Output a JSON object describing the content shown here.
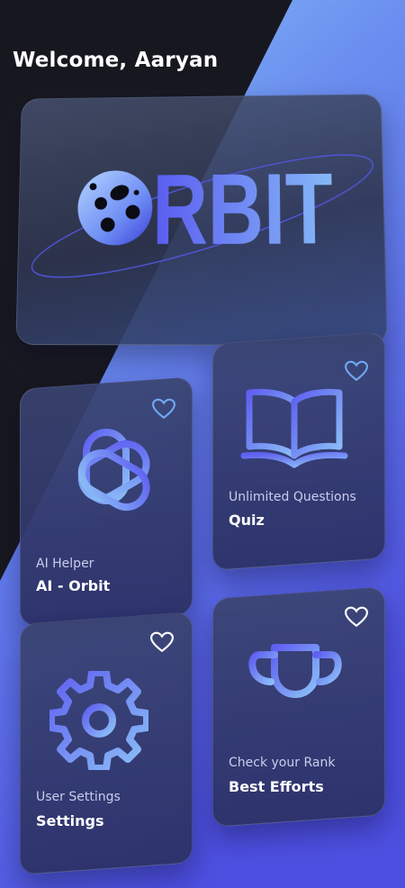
{
  "greeting": "Welcome, Aaryan",
  "hero": {
    "logo_text": "RBIT"
  },
  "cards": [
    {
      "subtitle": "AI Helper",
      "title": "AI - Orbit",
      "icon": "openai-icon"
    },
    {
      "subtitle": "Unlimited Questions",
      "title": "Quiz",
      "icon": "open-book-icon"
    },
    {
      "subtitle": "User Settings",
      "title": "Settings",
      "icon": "gear-icon"
    },
    {
      "subtitle": "Check your Rank",
      "title": "Best Efforts",
      "icon": "trophy-icon"
    }
  ],
  "colors": {
    "background_dark": "#17181f",
    "background_blue": "#5157e6",
    "accent_light_blue": "#7fb6f5",
    "card": "#363c70",
    "heart_blue": "#6fa8f0",
    "heart_white": "#ffffff"
  }
}
